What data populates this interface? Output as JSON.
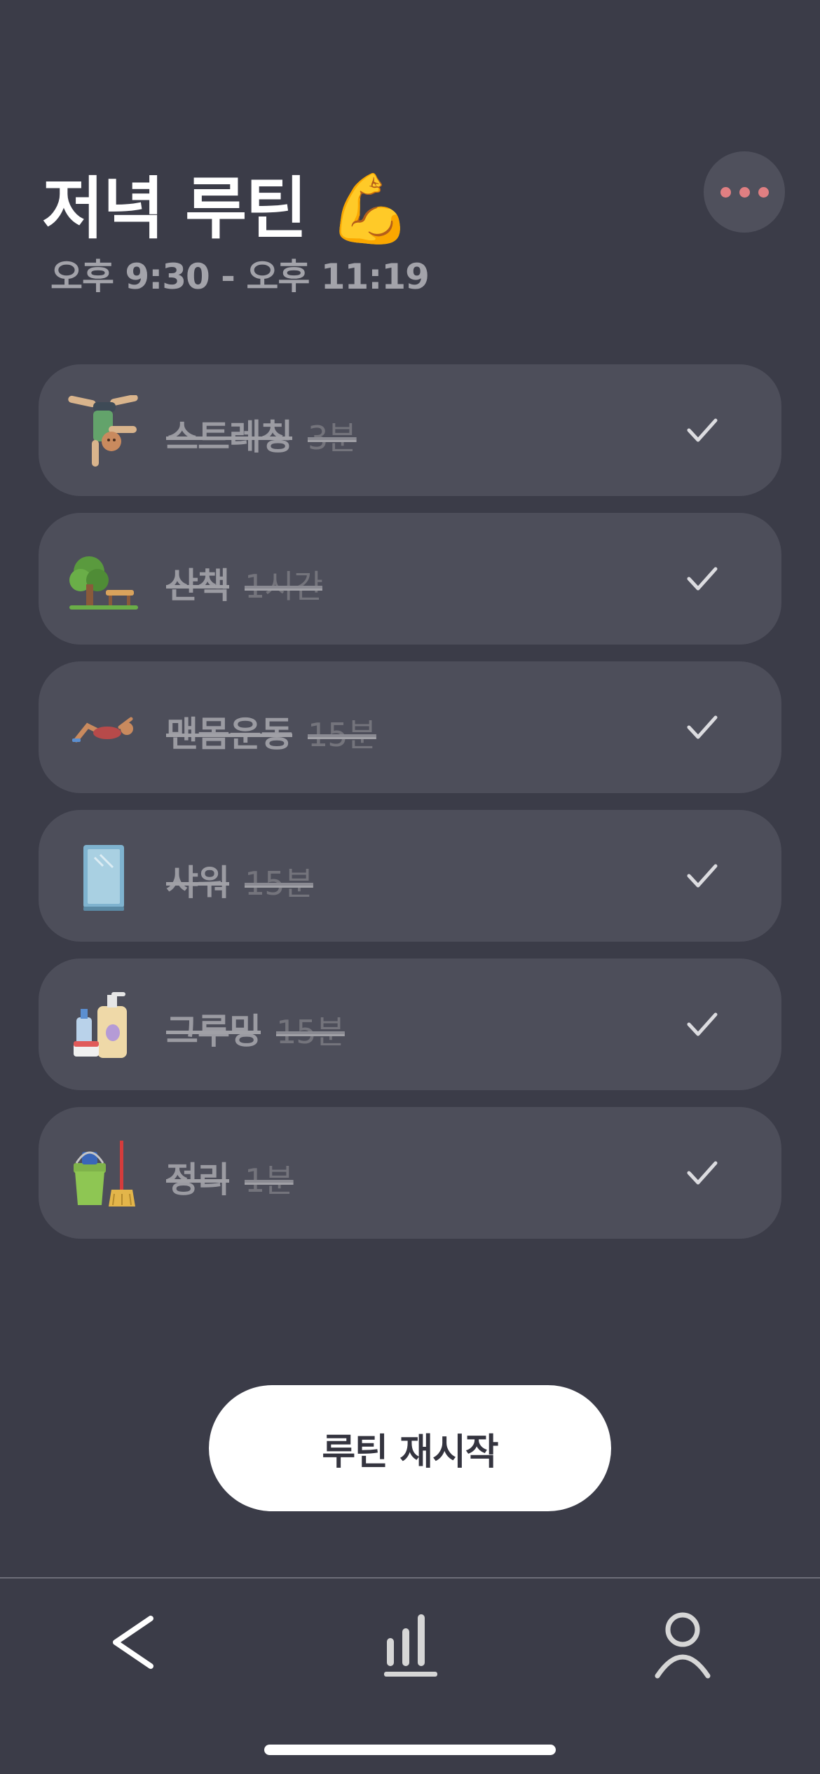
{
  "header": {
    "title": "저녁 루틴 💪",
    "time_range": "오후 9:30 - 오후 11:19"
  },
  "more_icon": "more-horizontal-icon",
  "routines": [
    {
      "icon": "person-cartwheeling-icon",
      "name": "스트레칭",
      "duration": "3분",
      "done": true
    },
    {
      "icon": "park-tree-bench-icon",
      "name": "산책",
      "duration": "1시간",
      "done": true
    },
    {
      "icon": "person-stretching-icon",
      "name": "맨몸운동",
      "duration": "15분",
      "done": true
    },
    {
      "icon": "shower-door-icon",
      "name": "샤워",
      "duration": "15분",
      "done": true
    },
    {
      "icon": "lotion-bottles-icon",
      "name": "그루밍",
      "duration": "15분",
      "done": true
    },
    {
      "icon": "bucket-broom-icon",
      "name": "정리",
      "duration": "1분",
      "done": true
    }
  ],
  "restart_label": "루틴 재시작",
  "tabbar": {
    "back_icon": "chevron-left-icon",
    "stats_icon": "bar-chart-icon",
    "profile_icon": "person-icon"
  },
  "colors": {
    "background": "#3b3c48",
    "card": "#4d4e5a",
    "accent_dots": "#e07f82",
    "button": "#ffffff"
  }
}
